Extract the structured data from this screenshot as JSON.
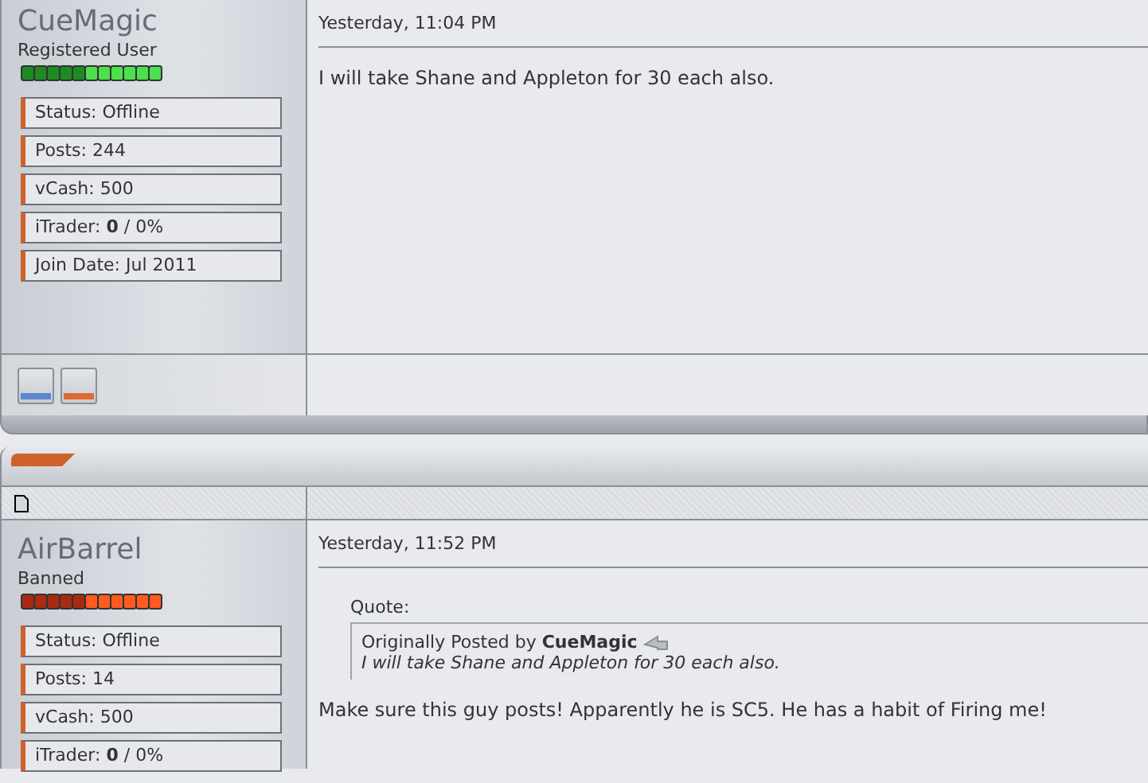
{
  "posts": [
    {
      "username": "CueMagic",
      "user_title": "Registered User",
      "reputation": {
        "kind": "positive"
      },
      "info": [
        {
          "label": "Status:",
          "value": "Offline"
        },
        {
          "label": "Posts:",
          "value": "244"
        },
        {
          "label": "vCash:",
          "value": "500"
        },
        {
          "label": "iTrader:",
          "value": "**0** / 0%"
        },
        {
          "label": "Join Date:",
          "value": "Jul 2011"
        }
      ],
      "date": "Yesterday, 11:04 PM",
      "message": "I will take Shane and Appleton for 30 each also.",
      "has_footer": true
    },
    {
      "username": "AirBarrel",
      "user_title": "Banned",
      "reputation": {
        "kind": "negative"
      },
      "info": [
        {
          "label": "Status:",
          "value": "Offline"
        },
        {
          "label": "Posts:",
          "value": "14"
        },
        {
          "label": "vCash:",
          "value": "500"
        },
        {
          "label": "iTrader:",
          "value": "**0** / 0%"
        }
      ],
      "date": "Yesterday, 11:52 PM",
      "quote": {
        "label": "Quote:",
        "prefix": "Originally Posted by",
        "author": "CueMagic",
        "text": "I will take Shane and Appleton for 30 each also."
      },
      "message": "Make sure this guy posts! Apparently he is SC5. He has a habit of Firing me!",
      "has_footer": false
    }
  ]
}
